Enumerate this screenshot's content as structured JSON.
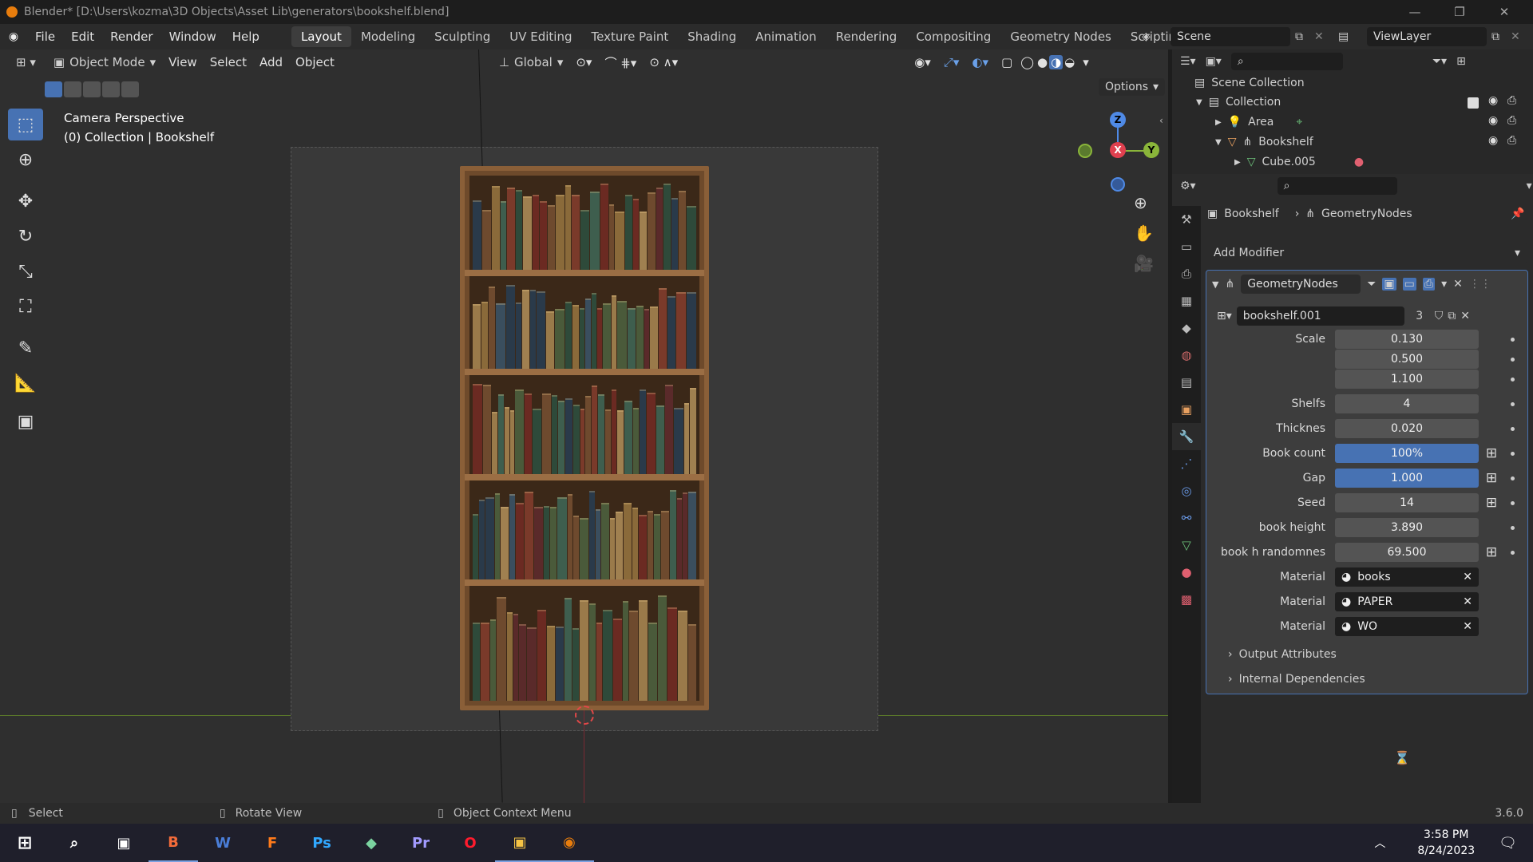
{
  "window": {
    "title": "Blender* [D:\\Users\\kozma\\3D Objects\\Asset Lib\\generators\\bookshelf.blend]"
  },
  "menubar": {
    "menus": [
      "File",
      "Edit",
      "Render",
      "Window",
      "Help"
    ],
    "workspaces": [
      "Layout",
      "Modeling",
      "Sculpting",
      "UV Editing",
      "Texture Paint",
      "Shading",
      "Animation",
      "Rendering",
      "Compositing",
      "Geometry Nodes",
      "Scripting"
    ],
    "active_workspace": "Layout",
    "add_workspace": "+",
    "scene": "Scene",
    "view_layer": "ViewLayer"
  },
  "viewport": {
    "mode": "Object Mode",
    "menus": [
      "View",
      "Select",
      "Add",
      "Object"
    ],
    "transform_orientation": "Global",
    "options": "Options",
    "overlay_title": "Camera Perspective",
    "overlay_subtitle": "(0) Collection | Bookshelf",
    "gizmo": {
      "x": "X",
      "y": "Y",
      "z": "Z"
    }
  },
  "outliner": {
    "items": [
      {
        "label": "Scene Collection",
        "icon": "scene-collection-icon"
      },
      {
        "label": "Collection",
        "icon": "collection-icon"
      },
      {
        "label": "Area",
        "icon": "light-icon"
      },
      {
        "label": "Bookshelf",
        "icon": "object-icon"
      },
      {
        "label": "Cube.005",
        "icon": "mesh-icon"
      }
    ]
  },
  "properties": {
    "breadcrumb_object": "Bookshelf",
    "breadcrumb_modifier": "GeometryNodes",
    "add_modifier": "Add Modifier",
    "modifier_name": "GeometryNodes",
    "node_group": "bookshelf.001",
    "node_group_users": "3",
    "params": [
      {
        "label": "Scale",
        "value": "0.130"
      },
      {
        "label": "",
        "value": "0.500"
      },
      {
        "label": "",
        "value": "1.100"
      },
      {
        "label": "Shelfs",
        "value": "4"
      },
      {
        "label": "Thicknes",
        "value": "0.020"
      },
      {
        "label": "Book count",
        "value": "100%"
      },
      {
        "label": "Gap",
        "value": "1.000"
      },
      {
        "label": "Seed",
        "value": "14"
      },
      {
        "label": "book height",
        "value": "3.890"
      },
      {
        "label": "book h randomnes",
        "value": "69.500"
      }
    ],
    "materials": [
      {
        "label": "Material",
        "value": "books"
      },
      {
        "label": "Material",
        "value": "PAPER"
      },
      {
        "label": "Material",
        "value": "WO"
      }
    ],
    "panels": [
      "Output Attributes",
      "Internal Dependencies"
    ]
  },
  "statusbar": {
    "left": "Select",
    "middle": "Rotate View",
    "right": "Object Context Menu",
    "version": "3.6.0"
  },
  "taskbar": {
    "time": "3:58 PM",
    "date": "8/24/2023",
    "apps": [
      "Brave",
      "Word",
      "Firefox",
      "Photoshop",
      "App",
      "Premiere",
      "Opera",
      "File Explorer",
      "Blender"
    ],
    "app_letters": [
      "B",
      "W",
      "F",
      "Ps",
      "◆",
      "Pr",
      "O",
      "▣",
      "◉"
    ]
  },
  "colors": {
    "accent": "#4772b3",
    "blender_orange": "#e87d0d"
  }
}
